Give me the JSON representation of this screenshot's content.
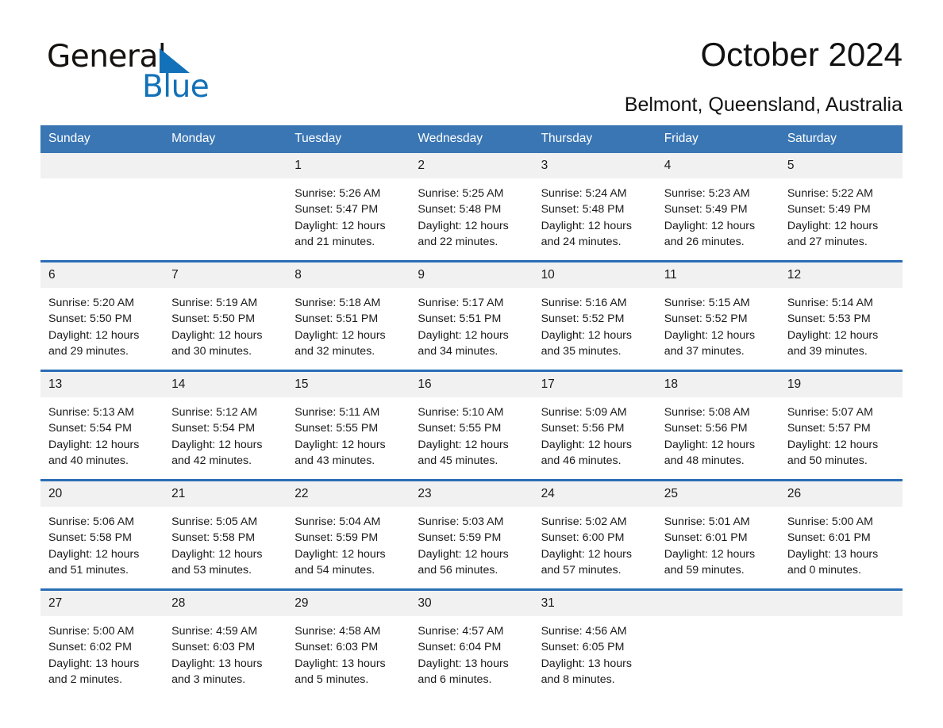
{
  "brand": {
    "name_part1": "General",
    "name_part2": "Blue",
    "accent_color": "#1271b8"
  },
  "header": {
    "title": "October 2024",
    "location": "Belmont, Queensland, Australia"
  },
  "theme": {
    "header_blue": "#3a76b4",
    "row_divider_blue": "#2a6db5",
    "date_band_gray": "#f1f1f1"
  },
  "weekdays": [
    "Sunday",
    "Monday",
    "Tuesday",
    "Wednesday",
    "Thursday",
    "Friday",
    "Saturday"
  ],
  "weeks": [
    {
      "days": [
        {
          "num": "",
          "lines": []
        },
        {
          "num": "",
          "lines": []
        },
        {
          "num": "1",
          "lines": [
            "Sunrise: 5:26 AM",
            "Sunset: 5:47 PM",
            "Daylight: 12 hours",
            "and 21 minutes."
          ]
        },
        {
          "num": "2",
          "lines": [
            "Sunrise: 5:25 AM",
            "Sunset: 5:48 PM",
            "Daylight: 12 hours",
            "and 22 minutes."
          ]
        },
        {
          "num": "3",
          "lines": [
            "Sunrise: 5:24 AM",
            "Sunset: 5:48 PM",
            "Daylight: 12 hours",
            "and 24 minutes."
          ]
        },
        {
          "num": "4",
          "lines": [
            "Sunrise: 5:23 AM",
            "Sunset: 5:49 PM",
            "Daylight: 12 hours",
            "and 26 minutes."
          ]
        },
        {
          "num": "5",
          "lines": [
            "Sunrise: 5:22 AM",
            "Sunset: 5:49 PM",
            "Daylight: 12 hours",
            "and 27 minutes."
          ]
        }
      ]
    },
    {
      "days": [
        {
          "num": "6",
          "lines": [
            "Sunrise: 5:20 AM",
            "Sunset: 5:50 PM",
            "Daylight: 12 hours",
            "and 29 minutes."
          ]
        },
        {
          "num": "7",
          "lines": [
            "Sunrise: 5:19 AM",
            "Sunset: 5:50 PM",
            "Daylight: 12 hours",
            "and 30 minutes."
          ]
        },
        {
          "num": "8",
          "lines": [
            "Sunrise: 5:18 AM",
            "Sunset: 5:51 PM",
            "Daylight: 12 hours",
            "and 32 minutes."
          ]
        },
        {
          "num": "9",
          "lines": [
            "Sunrise: 5:17 AM",
            "Sunset: 5:51 PM",
            "Daylight: 12 hours",
            "and 34 minutes."
          ]
        },
        {
          "num": "10",
          "lines": [
            "Sunrise: 5:16 AM",
            "Sunset: 5:52 PM",
            "Daylight: 12 hours",
            "and 35 minutes."
          ]
        },
        {
          "num": "11",
          "lines": [
            "Sunrise: 5:15 AM",
            "Sunset: 5:52 PM",
            "Daylight: 12 hours",
            "and 37 minutes."
          ]
        },
        {
          "num": "12",
          "lines": [
            "Sunrise: 5:14 AM",
            "Sunset: 5:53 PM",
            "Daylight: 12 hours",
            "and 39 minutes."
          ]
        }
      ]
    },
    {
      "days": [
        {
          "num": "13",
          "lines": [
            "Sunrise: 5:13 AM",
            "Sunset: 5:54 PM",
            "Daylight: 12 hours",
            "and 40 minutes."
          ]
        },
        {
          "num": "14",
          "lines": [
            "Sunrise: 5:12 AM",
            "Sunset: 5:54 PM",
            "Daylight: 12 hours",
            "and 42 minutes."
          ]
        },
        {
          "num": "15",
          "lines": [
            "Sunrise: 5:11 AM",
            "Sunset: 5:55 PM",
            "Daylight: 12 hours",
            "and 43 minutes."
          ]
        },
        {
          "num": "16",
          "lines": [
            "Sunrise: 5:10 AM",
            "Sunset: 5:55 PM",
            "Daylight: 12 hours",
            "and 45 minutes."
          ]
        },
        {
          "num": "17",
          "lines": [
            "Sunrise: 5:09 AM",
            "Sunset: 5:56 PM",
            "Daylight: 12 hours",
            "and 46 minutes."
          ]
        },
        {
          "num": "18",
          "lines": [
            "Sunrise: 5:08 AM",
            "Sunset: 5:56 PM",
            "Daylight: 12 hours",
            "and 48 minutes."
          ]
        },
        {
          "num": "19",
          "lines": [
            "Sunrise: 5:07 AM",
            "Sunset: 5:57 PM",
            "Daylight: 12 hours",
            "and 50 minutes."
          ]
        }
      ]
    },
    {
      "days": [
        {
          "num": "20",
          "lines": [
            "Sunrise: 5:06 AM",
            "Sunset: 5:58 PM",
            "Daylight: 12 hours",
            "and 51 minutes."
          ]
        },
        {
          "num": "21",
          "lines": [
            "Sunrise: 5:05 AM",
            "Sunset: 5:58 PM",
            "Daylight: 12 hours",
            "and 53 minutes."
          ]
        },
        {
          "num": "22",
          "lines": [
            "Sunrise: 5:04 AM",
            "Sunset: 5:59 PM",
            "Daylight: 12 hours",
            "and 54 minutes."
          ]
        },
        {
          "num": "23",
          "lines": [
            "Sunrise: 5:03 AM",
            "Sunset: 5:59 PM",
            "Daylight: 12 hours",
            "and 56 minutes."
          ]
        },
        {
          "num": "24",
          "lines": [
            "Sunrise: 5:02 AM",
            "Sunset: 6:00 PM",
            "Daylight: 12 hours",
            "and 57 minutes."
          ]
        },
        {
          "num": "25",
          "lines": [
            "Sunrise: 5:01 AM",
            "Sunset: 6:01 PM",
            "Daylight: 12 hours",
            "and 59 minutes."
          ]
        },
        {
          "num": "26",
          "lines": [
            "Sunrise: 5:00 AM",
            "Sunset: 6:01 PM",
            "Daylight: 13 hours",
            "and 0 minutes."
          ]
        }
      ]
    },
    {
      "days": [
        {
          "num": "27",
          "lines": [
            "Sunrise: 5:00 AM",
            "Sunset: 6:02 PM",
            "Daylight: 13 hours",
            "and 2 minutes."
          ]
        },
        {
          "num": "28",
          "lines": [
            "Sunrise: 4:59 AM",
            "Sunset: 6:03 PM",
            "Daylight: 13 hours",
            "and 3 minutes."
          ]
        },
        {
          "num": "29",
          "lines": [
            "Sunrise: 4:58 AM",
            "Sunset: 6:03 PM",
            "Daylight: 13 hours",
            "and 5 minutes."
          ]
        },
        {
          "num": "30",
          "lines": [
            "Sunrise: 4:57 AM",
            "Sunset: 6:04 PM",
            "Daylight: 13 hours",
            "and 6 minutes."
          ]
        },
        {
          "num": "31",
          "lines": [
            "Sunrise: 4:56 AM",
            "Sunset: 6:05 PM",
            "Daylight: 13 hours",
            "and 8 minutes."
          ]
        },
        {
          "num": "",
          "lines": []
        },
        {
          "num": "",
          "lines": []
        }
      ]
    }
  ]
}
